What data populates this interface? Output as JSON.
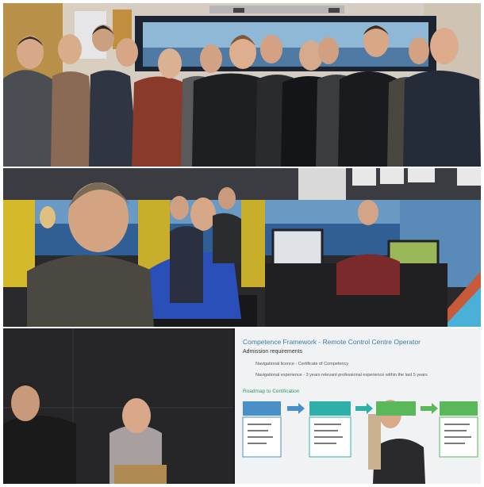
{
  "slide": {
    "title": "Competence Framework - Remote Control Centre Operator",
    "admission_heading": "Admission requirements",
    "admission_items": [
      "Navigational licence - Certificate of Competency",
      "Navigational experience - 3 years relevant professional experience within the last 5 years"
    ],
    "roadmap_heading": "Roadmap to Certification"
  },
  "colors": {
    "slide_title": "#3a7da6",
    "roadmap_blue": "#4a90c8",
    "roadmap_teal": "#2eb0a8",
    "roadmap_green": "#5ab85a"
  }
}
